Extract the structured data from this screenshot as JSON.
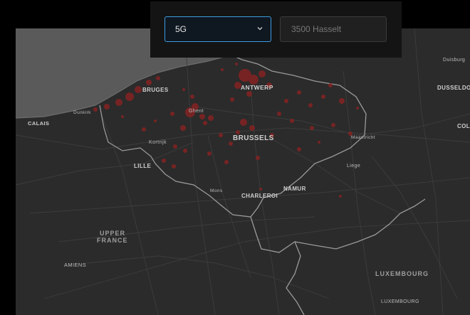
{
  "network_select": {
    "value": "5G"
  },
  "postcode_input": {
    "placeholder": "3500 Hasselt"
  },
  "colors": {
    "coverage": "#8a2222",
    "land": "#2b2b2b",
    "sea": "#5a5a5a",
    "selected_border": "#3e9be0"
  },
  "map": {
    "cities": {
      "bruges": "BRUGES",
      "antwerp": "ANTWERP",
      "ghent": "Ghent",
      "dunkirk": "Dunkirk",
      "calais": "CALAIS",
      "kortrijk": "Kortrijk",
      "brussels": "BRUSSELS",
      "maastricht": "Maastricht",
      "liege": "Liege",
      "lille": "LILLE",
      "mons": "Mons",
      "charleroi": "CHARLEROI",
      "namur": "NAMUR",
      "duisburg": "Duisburg",
      "dusseldorf": "DUSSELDORF",
      "cologne": "COLO",
      "amiens": "AMIENS",
      "luxembourg_city": "LUXEMBOURG"
    },
    "regions": {
      "upper_france_line1": "UPPER",
      "upper_france_line2": "FRANCE",
      "luxembourg_country": "LUXEMBOURG"
    }
  }
}
